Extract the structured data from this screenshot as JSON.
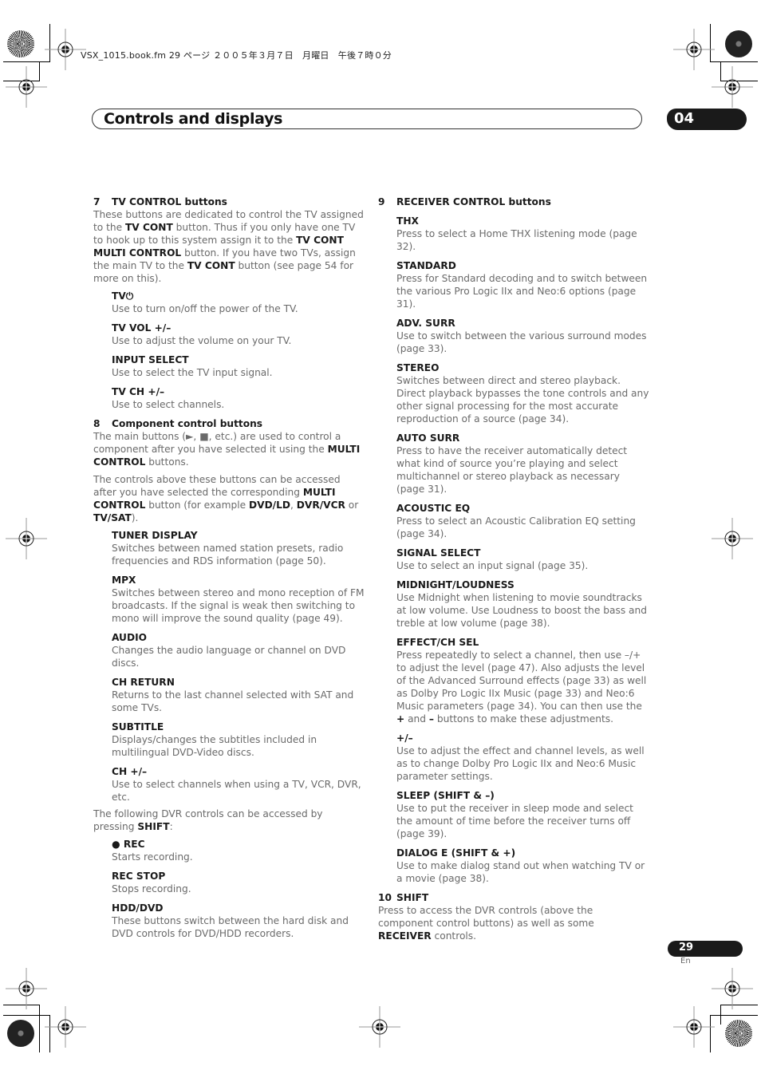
{
  "slug": "VSX_1015.book.fm  29 ページ  ２００５年３月７日　月曜日　午後７時０分",
  "header": {
    "title": "Controls and displays",
    "chapter": "04"
  },
  "left_column": {
    "sections": [
      {
        "number": "7",
        "title": "TV CONTROL buttons",
        "paragraphs": [
          "These buttons are dedicated to control the TV assigned to the <b>TV CONT</b> button. Thus if you only have one TV to hook up to this system assign it to the <b>TV CONT MULTI CONTROL</b> button. If you have two TVs, assign the main TV to the <b>TV CONT</b> button (see page 54 for more on this)."
        ],
        "items": [
          {
            "label": "TV⏻",
            "desc": "Use to turn on/off the power of the TV."
          },
          {
            "label": "TV VOL +/–",
            "desc": "Use to adjust the volume on your TV."
          },
          {
            "label": "INPUT SELECT",
            "desc": "Use to select the TV input signal."
          },
          {
            "label": "TV CH +/–",
            "desc": "Use to select channels."
          }
        ]
      },
      {
        "number": "8",
        "title": "Component control buttons",
        "paragraphs": [
          "The main buttons (►, ■, etc.) are used to control a component after you have selected it using the <b>MULTI CONTROL</b> buttons.",
          "The controls above these buttons can be accessed after you have selected the corresponding <b>MULTI CONTROL</b> button (for example <b>DVD/LD</b>, <b>DVR/VCR</b> or <b>TV/SAT</b>)."
        ],
        "items": [
          {
            "label": "TUNER DISPLAY",
            "desc": "Switches between named station presets, radio frequencies and RDS information (page 50)."
          },
          {
            "label": "MPX",
            "desc": "Switches between stereo and mono reception of FM broadcasts. If the signal is weak then switching to mono will improve the sound quality (page 49)."
          },
          {
            "label": "AUDIO",
            "desc": "Changes the audio language or channel on DVD discs."
          },
          {
            "label": "CH RETURN",
            "desc": "Returns to the last channel selected with SAT and some TVs."
          },
          {
            "label": "SUBTITLE",
            "desc": "Displays/changes the subtitles included in multilingual DVD-Video discs."
          },
          {
            "label": "CH +/–",
            "desc": "Use to select channels when using a TV, VCR, DVR, etc."
          }
        ],
        "after_paragraph": "The following DVR controls can be accessed by pressing <b>SHIFT</b>:",
        "after_items": [
          {
            "label": "● REC",
            "desc": "Starts recording."
          },
          {
            "label": "REC STOP",
            "desc": "Stops recording."
          },
          {
            "label": "HDD/DVD",
            "desc": "These buttons switch between the hard disk and DVD controls for DVD/HDD recorders."
          }
        ]
      }
    ]
  },
  "right_column": {
    "sections": [
      {
        "number": "9",
        "title": "RECEIVER CONTROL buttons",
        "items": [
          {
            "label": "THX",
            "desc": "Press to select a Home THX listening mode (page 32)."
          },
          {
            "label": "STANDARD",
            "desc": "Press for Standard decoding and to switch between the various Pro Logic IIx and Neo:6 options (page 31)."
          },
          {
            "label": "ADV. SURR",
            "desc": "Use to switch between the various surround modes (page 33)."
          },
          {
            "label": "STEREO",
            "desc": "Switches between direct and stereo playback. Direct playback bypasses the tone controls and any other signal processing for the most accurate reproduction of a source (page 34)."
          },
          {
            "label": "AUTO SURR",
            "desc": "Press to have the receiver automatically detect what kind of source you’re playing and select multichannel or stereo playback as necessary (page 31)."
          },
          {
            "label": "ACOUSTIC EQ",
            "desc": "Press to select an Acoustic Calibration EQ setting (page 34)."
          },
          {
            "label": "SIGNAL SELECT",
            "desc": "Use to select an input signal (page 35)."
          },
          {
            "label": "MIDNIGHT/LOUDNESS",
            "desc": "Use Midnight when listening to movie soundtracks at low volume. Use Loudness to boost the bass and treble at low volume (page 38)."
          },
          {
            "label": "EFFECT/CH SEL",
            "desc": "Press repeatedly to select a channel, then use –/+ to adjust the level (page 47). Also adjusts the level of the Advanced Surround effects (page 33) as well as Dolby Pro Logic IIx Music (page 33) and Neo:6 Music parameters (page 34). You can then use the <b>+</b> and <b>–</b> buttons to make these adjustments."
          },
          {
            "label": "+/–",
            "desc": "Use to adjust the effect and channel levels, as well as to change Dolby Pro Logic IIx and Neo:6 Music parameter settings."
          },
          {
            "label": "SLEEP (SHIFT & –)",
            "desc": "Use to put the receiver in sleep mode and select the amount of time before the receiver turns off (page 39)."
          },
          {
            "label": "DIALOG E (SHIFT & +)",
            "desc": "Use to make dialog stand out when watching TV or a movie (page 38)."
          }
        ]
      },
      {
        "number": "10",
        "title": "SHIFT",
        "paragraphs": [
          "Press to access the DVR controls (above the component control buttons) as well as some <b>RECEIVER</b> controls."
        ],
        "items": []
      }
    ]
  },
  "footer": {
    "page_number": "29",
    "language": "En"
  }
}
